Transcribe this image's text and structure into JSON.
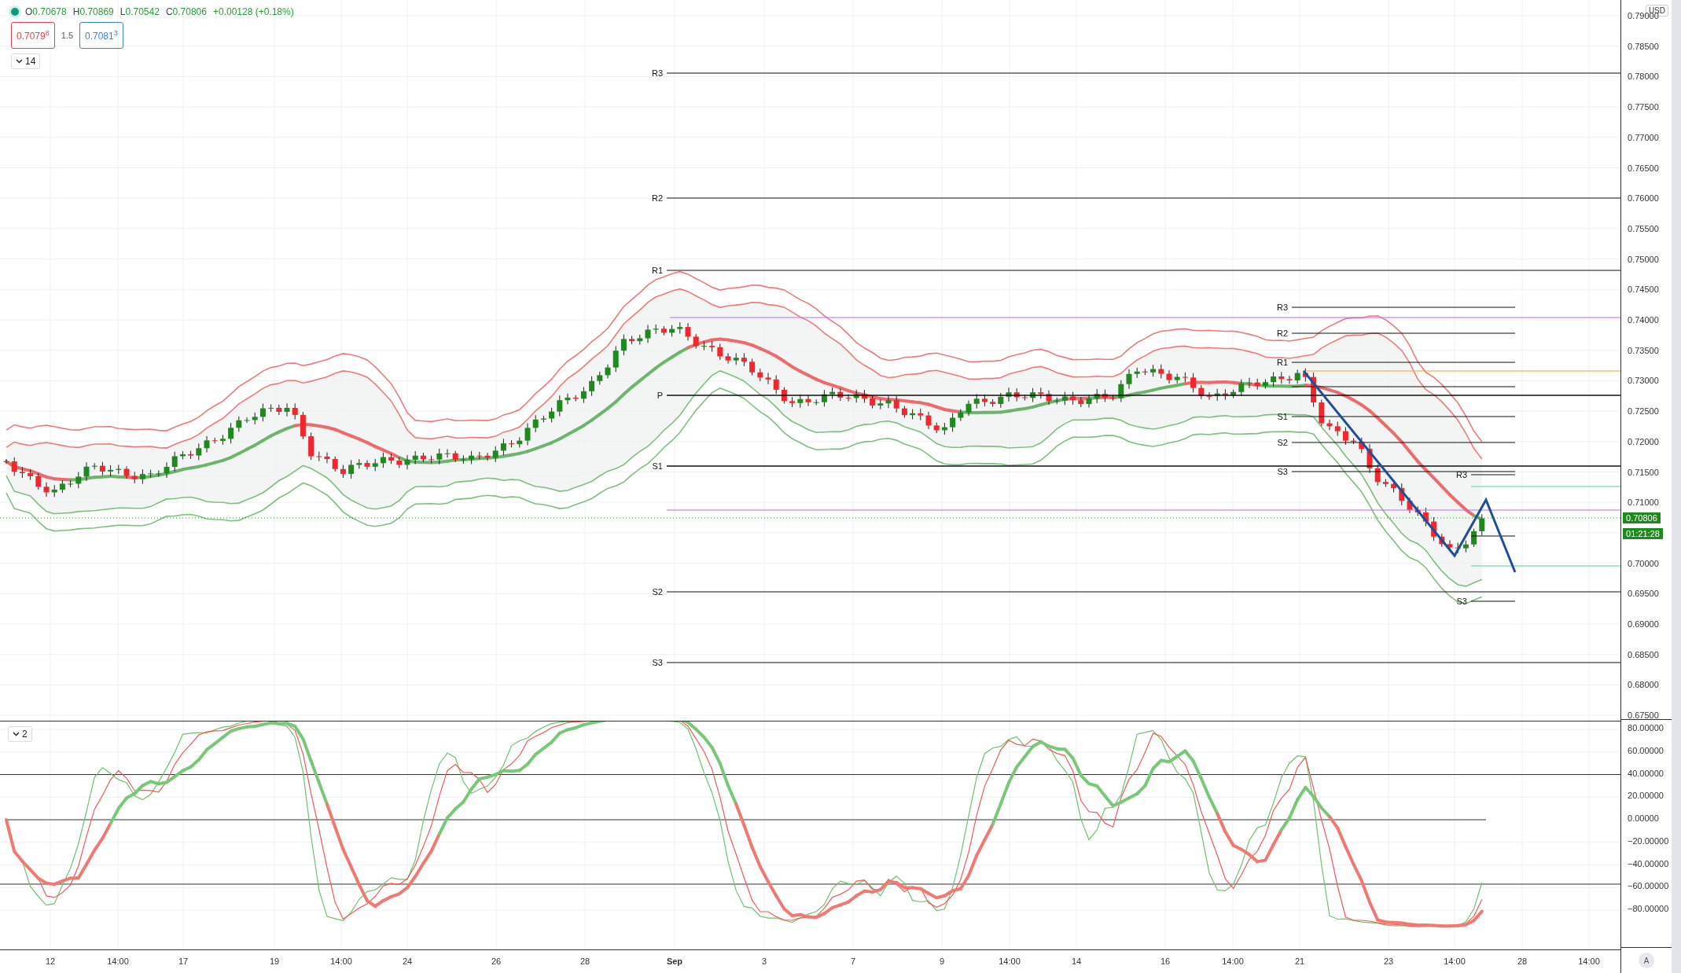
{
  "legend": {
    "values": [
      {
        "key": "O",
        "value": "0.70678"
      },
      {
        "key": "H",
        "value": "0.70869"
      },
      {
        "key": "L",
        "value": "0.70542"
      },
      {
        "key": "C",
        "value": "0.70806"
      }
    ],
    "change": "+0.00128 (+0.18%)"
  },
  "quote": {
    "bid": "0.7079$^{8}$",
    "spread": "1.5",
    "ask": "0.7081$^{3}$"
  },
  "main_pane": {
    "indicator_toggle": "14",
    "pivots_weekly": [
      "R3",
      "R2",
      "R1",
      "P",
      "S1",
      "S2",
      "S3"
    ],
    "pivots_daily": [
      "R3",
      "R2",
      "R1",
      "S1",
      "S2",
      "S3"
    ],
    "pivots_session": [
      "R3",
      "S3"
    ]
  },
  "oscillator_pane": {
    "indicator_toggle": "2"
  },
  "price_axis": {
    "currency": "USD",
    "labels": [
      "0.79000",
      "0.78500",
      "0.78000",
      "0.77500",
      "0.77000",
      "0.76500",
      "0.76000",
      "0.75500",
      "0.75000",
      "0.74500",
      "0.74000",
      "0.73500",
      "0.73000",
      "0.72500",
      "0.72000",
      "0.71500",
      "0.71000",
      "0.70000",
      "0.69500",
      "0.69000",
      "0.68500",
      "0.68000",
      "0.67500"
    ],
    "last_price": "0.70806",
    "countdown": "01:21:28"
  },
  "oscillator_axis": {
    "labels": [
      "80.00000",
      "60.00000",
      "40.00000",
      "20.00000",
      "0.00000",
      "−20.00000",
      "−40.00000",
      "−60.00000",
      "−80.00000"
    ]
  },
  "time_axis": {
    "labels": [
      {
        "text": "12",
        "kind": "day"
      },
      {
        "text": "14:00",
        "kind": "time"
      },
      {
        "text": "17",
        "kind": "day"
      },
      {
        "text": "19",
        "kind": "day"
      },
      {
        "text": "14:00",
        "kind": "time"
      },
      {
        "text": "24",
        "kind": "day"
      },
      {
        "text": "26",
        "kind": "day"
      },
      {
        "text": "28",
        "kind": "day"
      },
      {
        "text": "Sep",
        "kind": "month"
      },
      {
        "text": "3",
        "kind": "day"
      },
      {
        "text": "7",
        "kind": "day"
      },
      {
        "text": "9",
        "kind": "day"
      },
      {
        "text": "14:00",
        "kind": "time"
      },
      {
        "text": "14",
        "kind": "day"
      },
      {
        "text": "16",
        "kind": "day"
      },
      {
        "text": "14:00",
        "kind": "time"
      },
      {
        "text": "21",
        "kind": "day"
      },
      {
        "text": "23",
        "kind": "day"
      },
      {
        "text": "14:00",
        "kind": "time"
      },
      {
        "text": "28",
        "kind": "day"
      },
      {
        "text": "14:00",
        "kind": "time"
      }
    ],
    "auto_scale": "A"
  }
}
